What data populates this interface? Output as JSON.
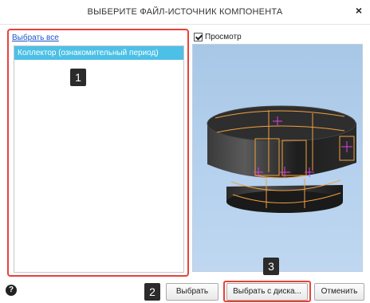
{
  "window": {
    "title": "ВЫБЕРИТЕ ФАЙЛ-ИСТОЧНИК КОМПОНЕНТА",
    "close_glyph": "×"
  },
  "left_panel": {
    "select_all_label": "Выбрать все",
    "items": [
      {
        "label": "Коллектор (ознакомительный период)",
        "selected": true
      }
    ]
  },
  "preview": {
    "checkbox_label": "Просмотр",
    "checked": true
  },
  "footer": {
    "help_glyph": "?",
    "select_label": "Выбрать",
    "select_from_disk_label": "Выбрать с диска...",
    "cancel_label": "Отменить"
  },
  "markers": {
    "m1": "1",
    "m2": "2",
    "m3": "3"
  },
  "colors": {
    "highlight": "#e8413a",
    "selection": "#4cc0e6",
    "preview_bg": "#b5d1ee",
    "model_edge": "#f0a040",
    "model_axis": "#e040e0"
  }
}
